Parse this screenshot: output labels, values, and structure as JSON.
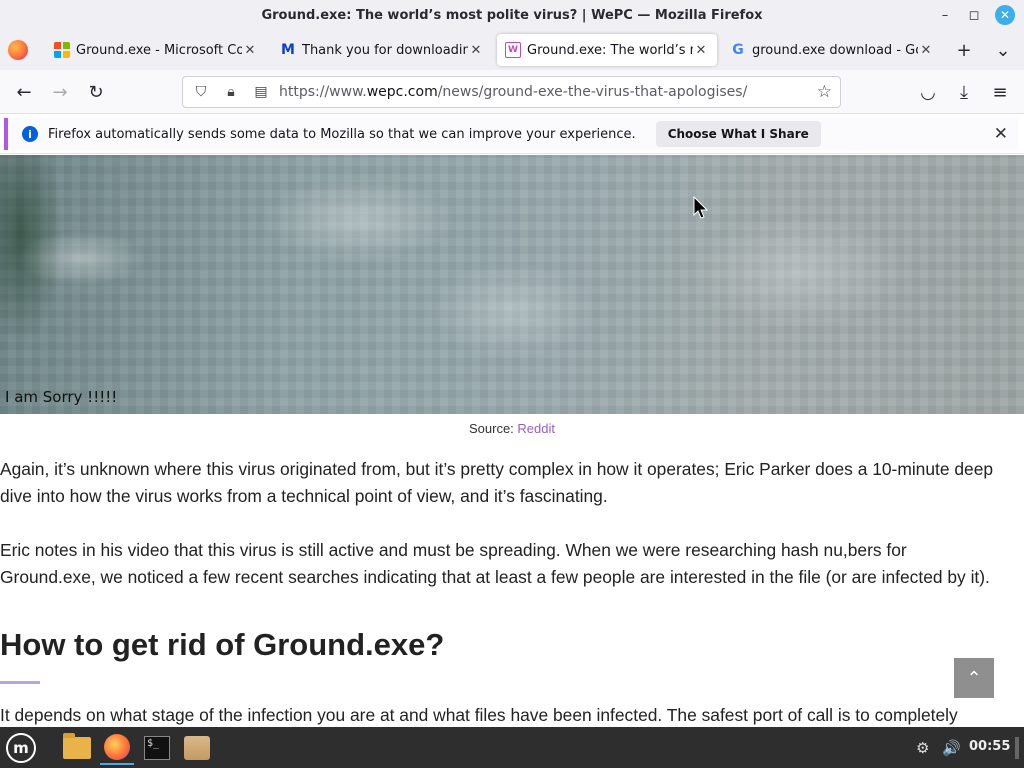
{
  "window": {
    "title": "Ground.exe: The world’s most polite virus? | WePC — Mozilla Firefox",
    "minimize_icon": "–",
    "maximize_icon": "◻",
    "close_icon": "✕"
  },
  "tabs": [
    {
      "label": "Ground.exe - Microsoft Community",
      "icon": "microsoft-icon",
      "active": false
    },
    {
      "label": "Thank you for downloading",
      "icon": "malwarebytes-icon",
      "active": false
    },
    {
      "label": "Ground.exe: The world’s most polite virus?",
      "icon": "wepc-icon",
      "active": true
    },
    {
      "label": "ground.exe download - Google Search",
      "icon": "google-icon",
      "active": false
    }
  ],
  "tabstrip": {
    "new_tab": "+",
    "list_all": "⌄"
  },
  "navbar": {
    "back": "←",
    "forward": "→",
    "reload": "↻",
    "url_prefix": "https://www.",
    "url_domain": "wepc.com",
    "url_path": "/news/ground-exe-the-virus-that-apologises/",
    "bookmark": "☆",
    "pocket": "◡",
    "downloads": "⤓",
    "menu": "≡"
  },
  "notification": {
    "text": "Firefox automatically sends some data to Mozilla so that we can improve your experience.",
    "button": "Choose What I Share",
    "close": "✕",
    "info": "i"
  },
  "article": {
    "image_caption": "I am Sorry !!!!!",
    "source_label": "Source:",
    "source_link": "Reddit",
    "para1_line1": "Again, it’s unknown where this virus originated from, but it’s pretty complex in how it operates; Eric Parker does a 10-minute deep",
    "para1_line2": "dive into how the virus works from a technical point of view, and it’s fascinating.",
    "para2_line1": "Eric notes in his video that this virus is still active and must be spreading. When we were researching hash nu,bers for",
    "para2_line2": "Ground.exe, we noticed a few recent searches indicating that at least a few people are interested in the file (or are infected by it).",
    "heading": "How to get rid of Ground.exe?",
    "para3_line1": "It depends on what stage of the infection you are at and what files have been infected. The safest port of call is to completely",
    "back_to_top": "⌃"
  },
  "taskbar": {
    "menu_label": "m",
    "terminal_text": "$_",
    "network": "⚙",
    "volume": "🔊",
    "clock": "00:55"
  }
}
